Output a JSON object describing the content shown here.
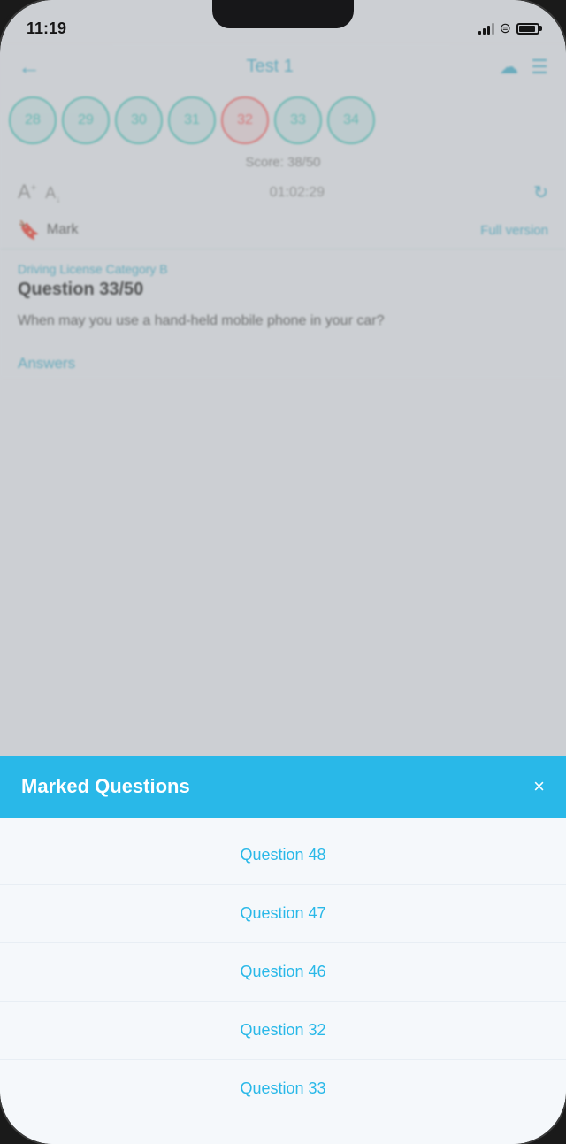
{
  "status": {
    "time": "11:19",
    "lock_icon": "🔒"
  },
  "header": {
    "title": "Test 1",
    "back_label": "←",
    "cloud_icon": "☁",
    "settings_icon": "⚙"
  },
  "question_numbers": [
    {
      "number": "28",
      "state": "green"
    },
    {
      "number": "29",
      "state": "green"
    },
    {
      "number": "30",
      "state": "green"
    },
    {
      "number": "31",
      "state": "green"
    },
    {
      "number": "32",
      "state": "red"
    },
    {
      "number": "33",
      "state": "green"
    },
    {
      "number": "34",
      "state": "green"
    }
  ],
  "score": {
    "label": "Score: 38/50"
  },
  "toolbar": {
    "timer": "01:02:29",
    "refresh_icon": "↻"
  },
  "mark": {
    "label": "Mark",
    "full_version_label": "Full version"
  },
  "question": {
    "category": "Driving License Category B",
    "title": "Question 33/50",
    "text": "When may you use a hand-held mobile phone in your car?"
  },
  "answers_label": "Answers",
  "modal": {
    "title": "Marked Questions",
    "close_label": "×",
    "items": [
      {
        "label": "Question 48"
      },
      {
        "label": "Question 47"
      },
      {
        "label": "Question 46"
      },
      {
        "label": "Question 32"
      },
      {
        "label": "Question 33"
      }
    ]
  }
}
